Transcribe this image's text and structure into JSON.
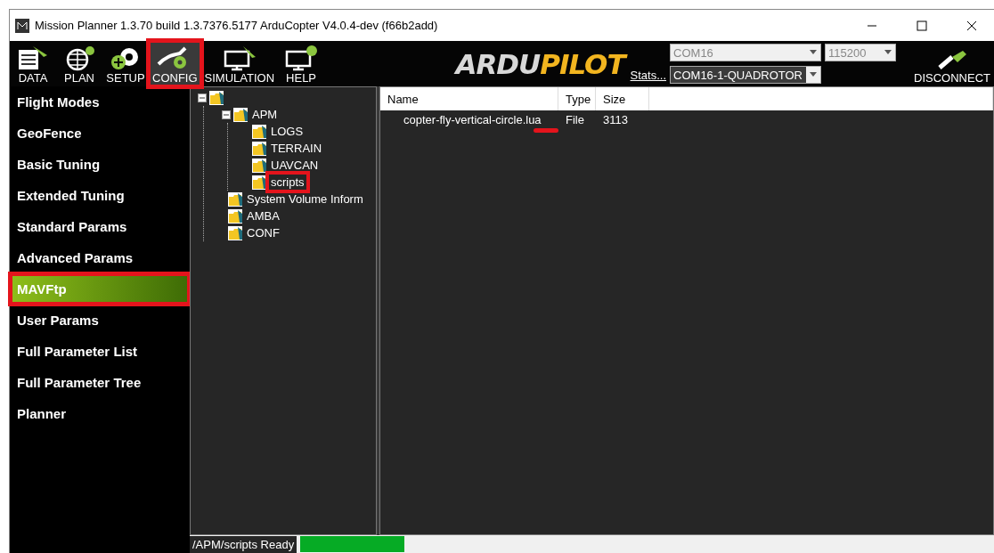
{
  "window": {
    "title": "Mission Planner 1.3.70 build 1.3.7376.5177 ArduCopter V4.0.4-dev (f66b2add)"
  },
  "toolbar": [
    {
      "label": "DATA",
      "kind": "data",
      "selected": false,
      "highlighted": false
    },
    {
      "label": "PLAN",
      "kind": "plan",
      "selected": false,
      "highlighted": false
    },
    {
      "label": "SETUP",
      "kind": "setup",
      "selected": false,
      "highlighted": false
    },
    {
      "label": "CONFIG",
      "kind": "config",
      "selected": true,
      "highlighted": true
    },
    {
      "label": "SIMULATION",
      "kind": "simulation",
      "selected": false,
      "highlighted": false
    },
    {
      "label": "HELP",
      "kind": "help",
      "selected": false,
      "highlighted": false
    }
  ],
  "logo": {
    "left": "ARDU",
    "right": "PILOT"
  },
  "connection": {
    "port": "COM16",
    "baud": "115200",
    "stats_link": "Stats...",
    "vehicle": "COM16-1-QUADROTOR",
    "disconnect": "DISCONNECT"
  },
  "sidebar": {
    "items": [
      {
        "label": "Flight Modes",
        "selected": false,
        "highlighted": false
      },
      {
        "label": "GeoFence",
        "selected": false,
        "highlighted": false
      },
      {
        "label": "Basic Tuning",
        "selected": false,
        "highlighted": false
      },
      {
        "label": "Extended Tuning",
        "selected": false,
        "highlighted": false
      },
      {
        "label": "Standard Params",
        "selected": false,
        "highlighted": false
      },
      {
        "label": "Advanced Params",
        "selected": false,
        "highlighted": false
      },
      {
        "label": "MAVFtp",
        "selected": true,
        "highlighted": true
      },
      {
        "label": "User Params",
        "selected": false,
        "highlighted": false
      },
      {
        "label": "Full Parameter List",
        "selected": false,
        "highlighted": false
      },
      {
        "label": "Full Parameter Tree",
        "selected": false,
        "highlighted": false
      },
      {
        "label": "Planner",
        "selected": false,
        "highlighted": false
      }
    ]
  },
  "tree": [
    {
      "expanded": true,
      "children": [
        {
          "label": "APM",
          "expanded": true,
          "highlighted": false,
          "children": [
            {
              "label": "LOGS",
              "highlighted": false
            },
            {
              "label": "TERRAIN",
              "highlighted": false
            },
            {
              "label": "UAVCAN",
              "highlighted": false
            },
            {
              "label": "scripts",
              "highlighted": true
            }
          ]
        },
        {
          "label": "System Volume Inform",
          "highlighted": false
        },
        {
          "label": "AMBA",
          "highlighted": false
        },
        {
          "label": "CONF",
          "highlighted": false
        }
      ]
    }
  ],
  "file_list": {
    "columns": [
      "Name",
      "Type",
      "Size"
    ],
    "rows": [
      {
        "cells": [
          "copter-fly-vertical-circle.lua",
          "File",
          "3113"
        ],
        "underlined": true
      }
    ]
  },
  "status_bar": {
    "text": "/APM/scripts Ready",
    "level": 0.15
  }
}
